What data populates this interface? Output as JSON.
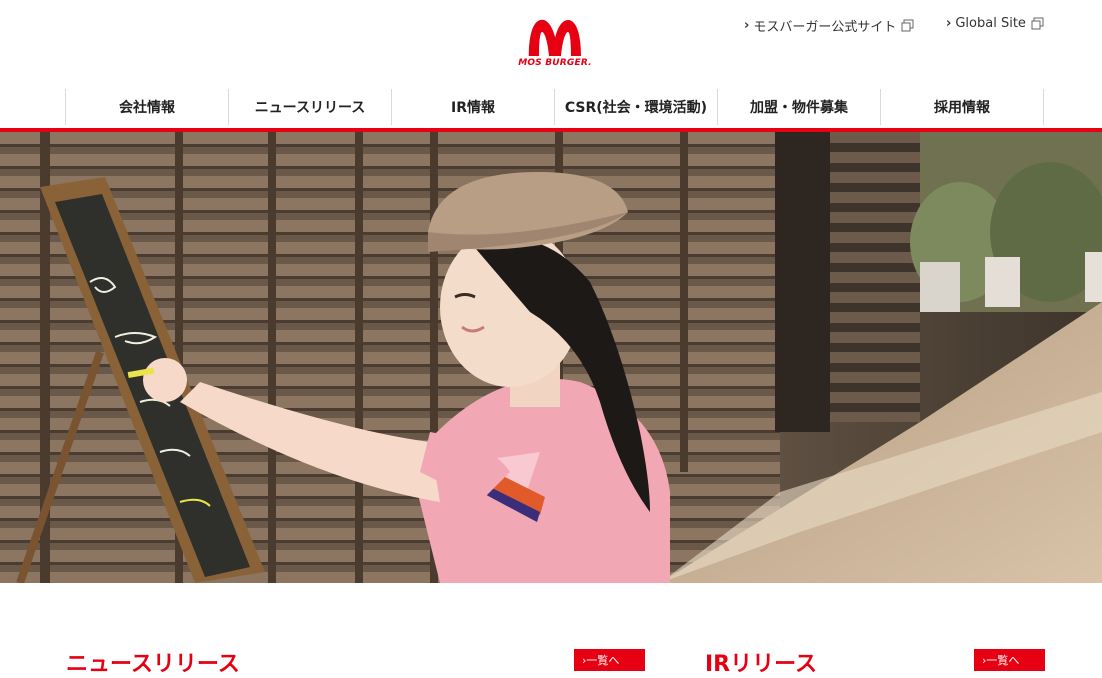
{
  "brand": {
    "logo_text": "MOS BURGER.",
    "red": "#e60012"
  },
  "utility_links": [
    {
      "label": "モスバーガー公式サイト",
      "icon": "external-link-icon"
    },
    {
      "label": "Global Site",
      "icon": "external-link-icon"
    }
  ],
  "nav": [
    {
      "label": "会社情報"
    },
    {
      "label": "ニュースリリース"
    },
    {
      "label": "IR情報"
    },
    {
      "label": "CSR(社会・環境活動)"
    },
    {
      "label": "加盟・物件募集"
    },
    {
      "label": "採用情報"
    }
  ],
  "sections": {
    "news": {
      "title": "ニュースリリース",
      "list_label": "一覧へ"
    },
    "ir": {
      "title": "IRリリース",
      "list_label": "一覧へ"
    }
  }
}
